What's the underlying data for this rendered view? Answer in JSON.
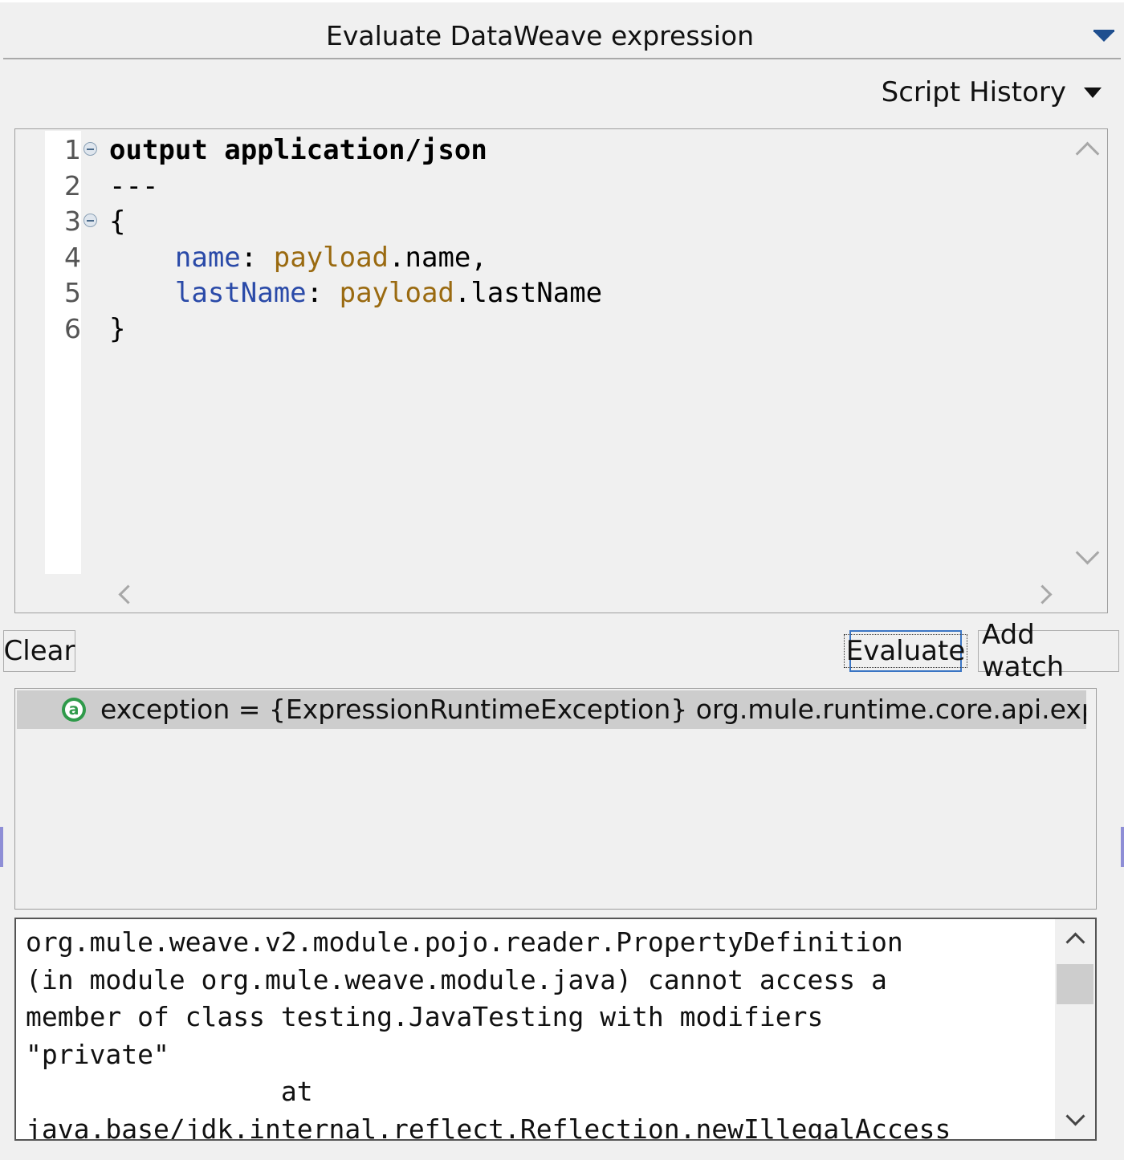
{
  "window": {
    "title": "Evaluate DataWeave expression"
  },
  "toolbar": {
    "script_history_label": "Script History"
  },
  "editor": {
    "lines": [
      {
        "number": "1",
        "tokens": [
          {
            "cls": "kw",
            "text": "output application/json"
          }
        ],
        "foldable": true
      },
      {
        "number": "2",
        "tokens": [
          {
            "cls": "txt",
            "text": "---"
          }
        ],
        "foldable": false
      },
      {
        "number": "3",
        "tokens": [
          {
            "cls": "txt",
            "text": "{"
          }
        ],
        "foldable": true
      },
      {
        "number": "4",
        "tokens": [
          {
            "cls": "txt",
            "text": "    "
          },
          {
            "cls": "key",
            "text": "name"
          },
          {
            "cls": "txt",
            "text": ": "
          },
          {
            "cls": "pay",
            "text": "payload"
          },
          {
            "cls": "txt",
            "text": ".name,"
          }
        ],
        "foldable": false
      },
      {
        "number": "5",
        "tokens": [
          {
            "cls": "txt",
            "text": "    "
          },
          {
            "cls": "key",
            "text": "lastName"
          },
          {
            "cls": "txt",
            "text": ": "
          },
          {
            "cls": "pay",
            "text": "payload"
          },
          {
            "cls": "txt",
            "text": ".lastName"
          }
        ],
        "foldable": false
      },
      {
        "number": "6",
        "tokens": [
          {
            "cls": "txt",
            "text": "}"
          }
        ],
        "foldable": false
      }
    ]
  },
  "buttons": {
    "clear_label": "Clear",
    "evaluate_label": "Evaluate",
    "add_watch_label": "Add watch"
  },
  "result": {
    "icon_letter": "a",
    "text": "exception = {ExpressionRuntimeException} org.mule.runtime.core.api.expressio"
  },
  "detail": {
    "text": "org.mule.weave.v2.module.pojo.reader.PropertyDefinition\n(in module org.mule.weave.module.java) cannot access a\nmember of class testing.JavaTesting with modifiers\n\"private\"\n                at\njava.base/jdk.internal.reflect.Reflection.newIllegalAccess"
  },
  "colors": {
    "keyword": "#000000",
    "field_key": "#2a4aa8",
    "payload": "#9a6a10",
    "result_icon": "#2f9a4a",
    "focus_border": "#3a75c4"
  }
}
